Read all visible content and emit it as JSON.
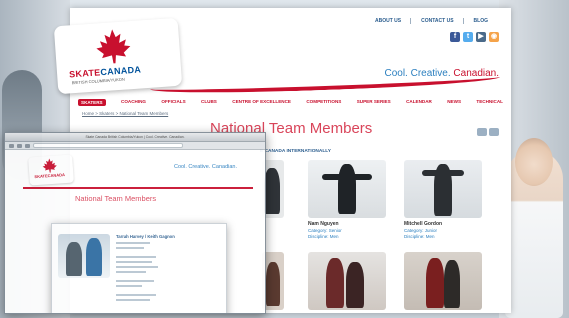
{
  "header": {
    "top_links": [
      "ABOUT US",
      "CONTACT US",
      "BLOG"
    ],
    "social_icons": [
      "facebook-icon",
      "twitter-icon",
      "youtube-icon",
      "rss-icon"
    ],
    "logo_text_left": "SKATE",
    "logo_text_right": "CANADA",
    "logo_sub": "BRITISH COLUMBIA/YUKON",
    "tagline_a": "Cool. Creative. ",
    "tagline_b": "Canadian."
  },
  "nav": {
    "items": [
      "SKATERS",
      "COACHING",
      "OFFICIALS",
      "CLUBS",
      "CENTRE OF EXCELLENCE",
      "COMPETITIONS",
      "SUPER SERIES",
      "CALENDAR",
      "NEWS",
      "TECHNICAL"
    ]
  },
  "breadcrumb": "Home > Skaters > National Team Members",
  "page": {
    "title": "National Team Members",
    "section_label": "E CANADA INTERNATIONALLY"
  },
  "athletes": [
    {
      "name": "Nam Nguyen",
      "category": "Category: Senior",
      "discipline": "Discipline: Men"
    },
    {
      "name": "Mitchell Gordon",
      "category": "Category: Junior",
      "discipline": "Discipline: Men"
    }
  ],
  "overlay": {
    "window_title": "Skate Canada British Columbia/Yukon | Cool. Creative. Canadian.",
    "logo_text": "SKATECANADA",
    "tagline": "Cool. Creative. Canadian.",
    "title": "National Team Members",
    "modal_name": "Tarrah Harvey / Keith Gagnon"
  },
  "colors": {
    "brand_red": "#c8102e",
    "brand_blue": "#2b7fbf",
    "title_pink": "#d9455a"
  }
}
